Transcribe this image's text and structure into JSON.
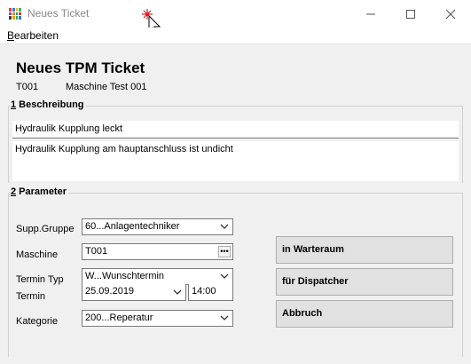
{
  "window": {
    "title": "Neues Ticket",
    "icon": "app-grid-icon",
    "controls": [
      "minimize-icon",
      "maximize-icon",
      "close-icon"
    ]
  },
  "menu": {
    "edit": {
      "mnemonic": "B",
      "rest": "earbeiten"
    }
  },
  "header": {
    "title": "Neues TPM Ticket",
    "ticket_id": "T001",
    "machine_name": "Maschine Test 001"
  },
  "description": {
    "section_number": "1",
    "section_title": " Beschreibung",
    "summary": "Hydraulik Kupplung leckt",
    "details": "Hydraulik Kupplung am hauptanschluss ist undicht"
  },
  "parameters": {
    "section_number": "2",
    "section_title": " Parameter",
    "supp_gruppe": {
      "label": "Supp.Gruppe",
      "value": "60...Anlagentechniker"
    },
    "maschine": {
      "label": "Maschine",
      "value": "T001"
    },
    "termin_typ": {
      "label": "Termin Typ",
      "value": "W...Wunschtermin"
    },
    "termin": {
      "label": "Termin",
      "date": "25.09.2019",
      "time": "14:00"
    },
    "kategorie": {
      "label": "Kategorie",
      "value": "200...Reperatur"
    }
  },
  "actions": {
    "waiting_room": "in Warteraum",
    "dispatcher": "für Dispatcher",
    "cancel": "Abbruch"
  },
  "colors": {
    "window_bg": "#f0f0f0",
    "titlebar_bg": "#ffffff",
    "button_bg": "#e1e1e1",
    "cursor_star": "#e0202a"
  }
}
